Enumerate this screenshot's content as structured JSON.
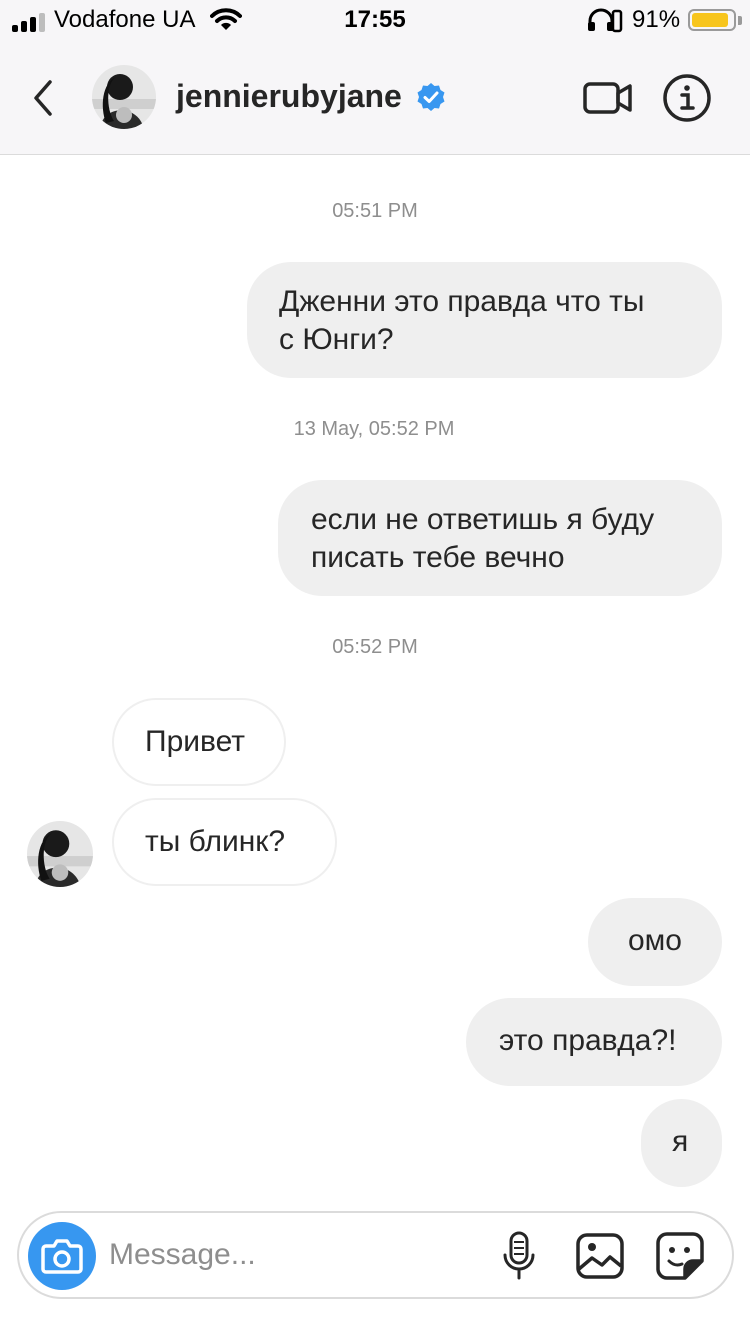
{
  "status_bar": {
    "carrier": "Vodafone UA",
    "time": "17:55",
    "battery_percent": "91%",
    "battery_level": 0.91,
    "signal_bars": 3,
    "icons": [
      "signal-icon",
      "wifi-icon",
      "headphones-icon",
      "orientation-lock-icon",
      "battery-icon"
    ]
  },
  "header": {
    "username": "jennierubyjane",
    "verified": true,
    "icons": [
      "back-chevron-icon",
      "verified-badge-icon",
      "video-call-icon",
      "info-icon"
    ]
  },
  "messages": [
    {
      "type": "timestamp",
      "text": "05:51 PM"
    },
    {
      "type": "outgoing",
      "lines": [
        "Дженни это правда что ты",
        "с Юнги?"
      ]
    },
    {
      "type": "timestamp",
      "text": "13 May, 05:52 PM"
    },
    {
      "type": "outgoing",
      "lines": [
        "если не ответишь я буду",
        "писать тебе вечно"
      ]
    },
    {
      "type": "timestamp",
      "text": "05:52 PM"
    },
    {
      "type": "incoming",
      "text": "Привет"
    },
    {
      "type": "incoming",
      "text": "ты блинк?"
    },
    {
      "type": "outgoing",
      "text": "омо"
    },
    {
      "type": "outgoing",
      "text": "это правда?!"
    },
    {
      "type": "outgoing",
      "text": "я"
    }
  ],
  "composer": {
    "placeholder": "Message...",
    "value": "",
    "icons": [
      "camera-icon",
      "microphone-icon",
      "gallery-icon",
      "sticker-icon"
    ]
  },
  "colors": {
    "accent_blue": "#3797f0",
    "verified_blue": "#3897f0",
    "outgoing_bubble": "#efefef",
    "battery_yellow": "#f7c51d"
  }
}
